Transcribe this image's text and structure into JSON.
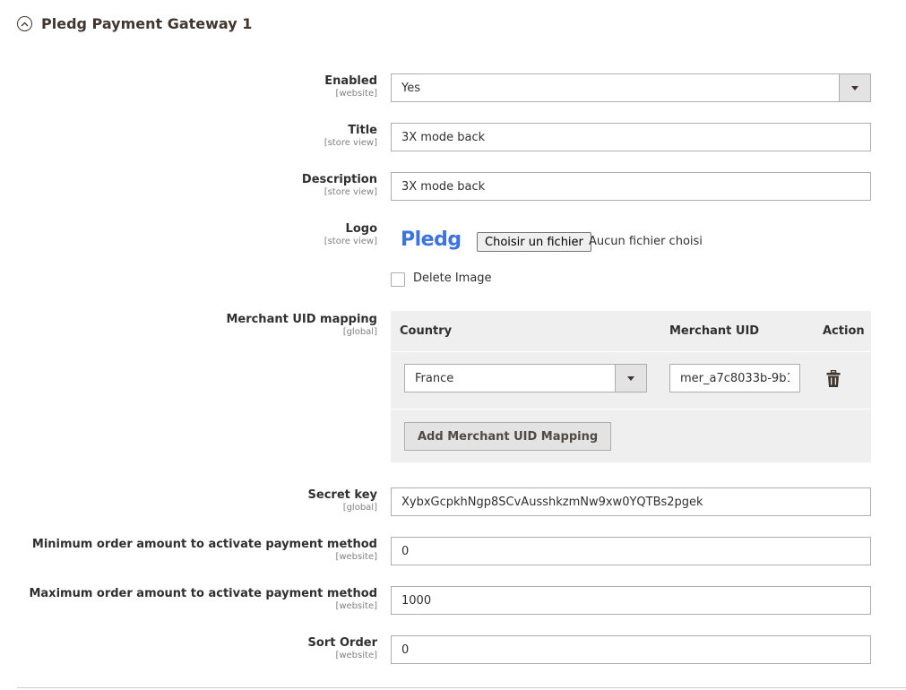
{
  "section": {
    "title": "Pledg Payment Gateway 1"
  },
  "fields": {
    "enabled": {
      "label": "Enabled",
      "scope": "[website]",
      "value": "Yes"
    },
    "title": {
      "label": "Title",
      "scope": "[store view]",
      "value": "3X mode back"
    },
    "description": {
      "label": "Description",
      "scope": "[store view]",
      "value": "3X mode back"
    },
    "logo": {
      "label": "Logo",
      "scope": "[store view]",
      "image_text": "Pledg",
      "file_button": "Choisir un fichier",
      "file_status": "Aucun fichier choisi",
      "delete_label": "Delete Image"
    },
    "merchant_uid_mapping": {
      "label": "Merchant UID mapping",
      "scope": "[global]",
      "columns": {
        "country": "Country",
        "merchant_uid": "Merchant UID",
        "action": "Action"
      },
      "rows": [
        {
          "country": "France",
          "merchant_uid": "mer_a7c8033b-9b1"
        }
      ],
      "add_button": "Add Merchant UID Mapping"
    },
    "secret_key": {
      "label": "Secret key",
      "scope": "[global]",
      "value": "XybxGcpkhNgp8SCvAusshkzmNw9xw0YQTBs2pgek"
    },
    "min_order": {
      "label": "Minimum order amount to activate payment method",
      "scope": "[website]",
      "value": "0"
    },
    "max_order": {
      "label": "Maximum order amount to activate payment method",
      "scope": "[website]",
      "value": "1000"
    },
    "sort_order": {
      "label": "Sort Order",
      "scope": "[website]",
      "value": "0"
    }
  },
  "colors": {
    "logo_blue": "#3b74e0",
    "grid_bg": "#efefef",
    "border": "#adadad"
  }
}
